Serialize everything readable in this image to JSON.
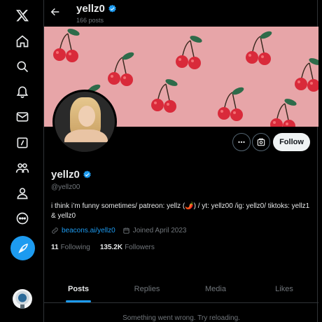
{
  "nav": {
    "items": [
      {
        "name": "x-logo-icon"
      },
      {
        "name": "home-icon"
      },
      {
        "name": "search-icon"
      },
      {
        "name": "notifications-icon"
      },
      {
        "name": "messages-icon"
      },
      {
        "name": "grok-icon"
      },
      {
        "name": "communities-icon"
      },
      {
        "name": "profile-icon"
      },
      {
        "name": "more-icon"
      }
    ],
    "compose_icon": "compose-feather-icon"
  },
  "header": {
    "name": "yellz0",
    "posts_count": "166 posts"
  },
  "profile": {
    "display_name": "yellz0",
    "handle": "@yellz00",
    "bio": "i think i’m funny sometimes/ patreon: yellz (🌶️) / yt: yellz00 /ig: yellz0/ tiktoks: yellz1 & yellz0",
    "website": "beacons.ai/yellz0",
    "joined": "Joined April 2023",
    "following_count": "11",
    "following_label": "Following",
    "followers_count": "135.2K",
    "followers_label": "Followers",
    "follow_button": "Follow"
  },
  "tabs": [
    {
      "label": "Posts",
      "active": true
    },
    {
      "label": "Replies",
      "active": false
    },
    {
      "label": "Media",
      "active": false
    },
    {
      "label": "Likes",
      "active": false
    }
  ],
  "status_message": "Something went wrong. Try reloading.",
  "colors": {
    "accent": "#1d9bf0",
    "banner": "#e7a5a8",
    "cherry": "#d92a3a",
    "leaf": "#2e6b4a"
  }
}
